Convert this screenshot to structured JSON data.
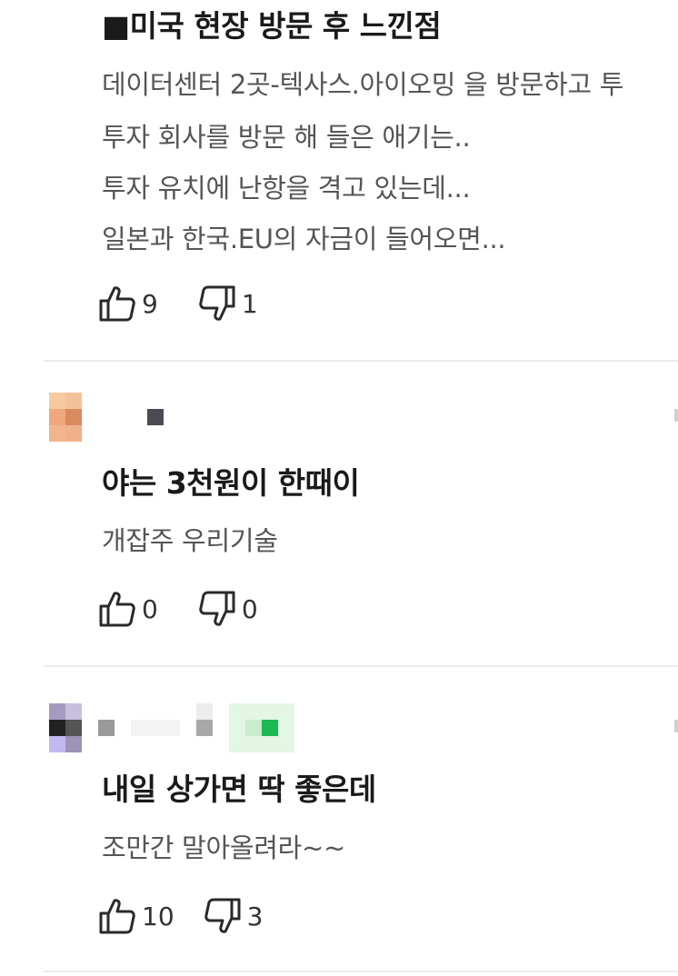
{
  "posts": [
    {
      "title": "■미국 현장 방문 후 느낀점",
      "lines": [
        "데이터센터 2곳-텍사스.아이오밍 을 방문하고 투",
        "투자 회사를 방문 해 들은 애기는..",
        "투자 유치에 난항을 격고 있는데...",
        "일본과 한국.EU의 자금이 들어오면..."
      ],
      "likes": "9",
      "dislikes": "1"
    },
    {
      "title": "야는 3천원이 한때이",
      "lines": [
        "개잡주 우리기술"
      ],
      "likes": "0",
      "dislikes": "0"
    },
    {
      "title": "내일 상가면 딱 좋은데",
      "lines": [
        "조만간 말아올려라~~"
      ],
      "likes": "10",
      "dislikes": "3"
    }
  ],
  "icons": {
    "like": "thumbs-up-icon",
    "dislike": "thumbs-down-icon",
    "more": "more-options-icon"
  },
  "colors": {
    "text_primary": "#1a1a1a",
    "text_secondary": "#555555",
    "divider": "#ececec",
    "badge_green": "#1db954"
  }
}
